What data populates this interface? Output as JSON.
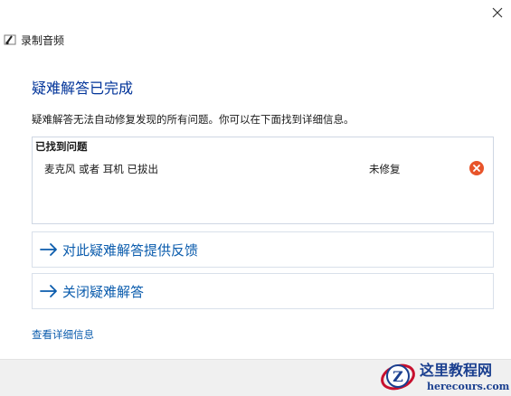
{
  "window": {
    "title": "录制音频"
  },
  "heading": "疑难解答已完成",
  "description": "疑难解答无法自动修复发现的所有问题。你可以在下面找到详细信息。",
  "issues": {
    "header": "已找到问题",
    "items": [
      {
        "name": "麦克风 或者 耳机 已拔出",
        "status": "未修复"
      }
    ]
  },
  "actions": [
    {
      "label": "对此疑难解答提供反馈"
    },
    {
      "label": "关闭疑难解答"
    }
  ],
  "details_link": "查看详细信息",
  "watermark": {
    "text": "这里教程网",
    "url": "herecours.com",
    "glyph": "Z"
  },
  "colors": {
    "heading": "#003399",
    "link": "#0b5cad",
    "error_badge": "#e8542a",
    "watermark_red": "#c8102e",
    "watermark_blue": "#1a3f8f"
  }
}
